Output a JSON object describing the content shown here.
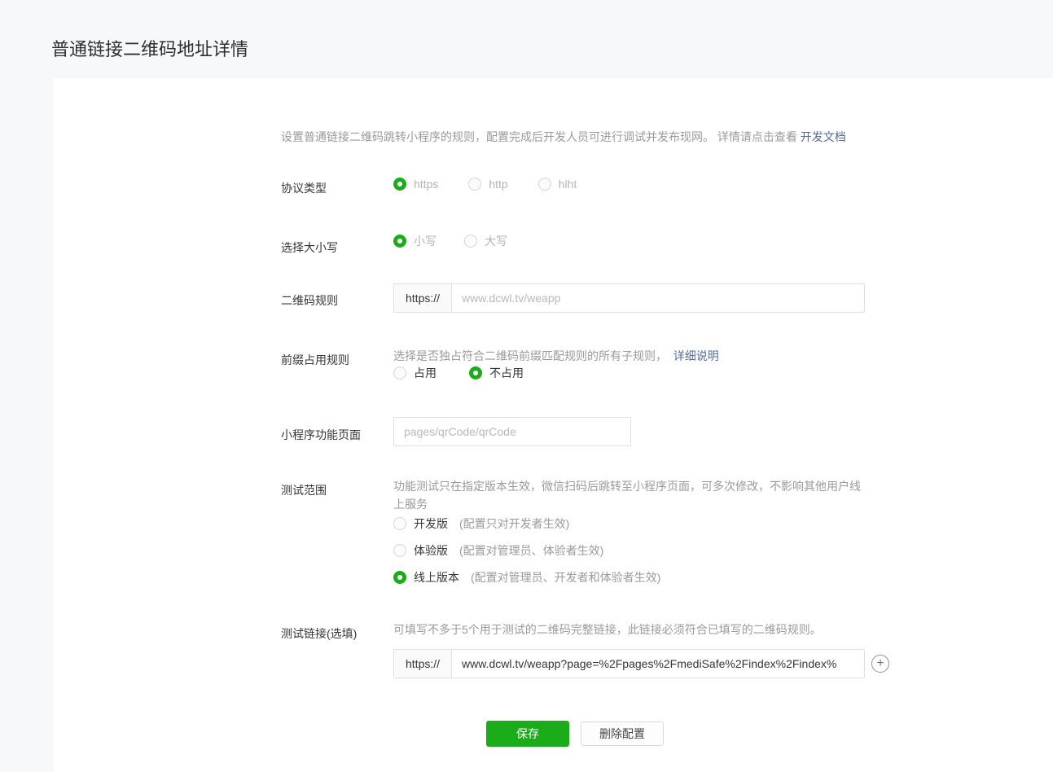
{
  "page": {
    "title": "普通链接二维码地址详情"
  },
  "intro": {
    "text": "设置普通链接二维码跳转小程序的规则，配置完成后开发人员可进行调试并发布现网。 详情请点击查看 ",
    "link": "开发文档"
  },
  "form": {
    "protocol": {
      "label": "协议类型",
      "options": [
        {
          "label": "https",
          "selected": true
        },
        {
          "label": "http",
          "selected": false
        },
        {
          "label": "hlht",
          "selected": false
        }
      ]
    },
    "letter_case": {
      "label": "选择大小写",
      "options": [
        {
          "label": "小写",
          "selected": true
        },
        {
          "label": "大写",
          "selected": false
        }
      ]
    },
    "qr_rule": {
      "label": "二维码规则",
      "prefix": "https://",
      "placeholder": "www.dcwl.tv/weapp"
    },
    "prefix_rule": {
      "label": "前缀占用规则",
      "description": "选择是否独占符合二维码前缀匹配规则的所有子规则，",
      "link": "详细说明",
      "options": [
        {
          "label": "占用",
          "selected": false
        },
        {
          "label": "不占用",
          "selected": true
        }
      ]
    },
    "feature_page": {
      "label": "小程序功能页面",
      "placeholder": "pages/qrCode/qrCode"
    },
    "test_scope": {
      "label": "测试范围",
      "description": "功能测试只在指定版本生效，微信扫码后跳转至小程序页面，可多次修改，不影响其他用户线上服务",
      "options": [
        {
          "label": "开发版",
          "hint": "(配置只对开发者生效)",
          "selected": false
        },
        {
          "label": "体验版",
          "hint": "(配置对管理员、体验者生效)",
          "selected": false
        },
        {
          "label": "线上版本",
          "hint": "(配置对管理员、开发者和体验者生效)",
          "selected": true
        }
      ]
    },
    "test_link": {
      "label": "测试链接(选填)",
      "description": "可填写不多于5个用于测试的二维码完整链接，此链接必须符合已填写的二维码规则。",
      "prefix": "https://",
      "value": "www.dcwl.tv/weapp?page=%2Fpages%2FmediSafe%2Findex%2Findex%",
      "add_icon": "+"
    }
  },
  "actions": {
    "save": "保存",
    "delete": "删除配置"
  },
  "colors": {
    "green": "#1aad19",
    "link_blue": "#576b95",
    "background": "#f7f8fa"
  }
}
